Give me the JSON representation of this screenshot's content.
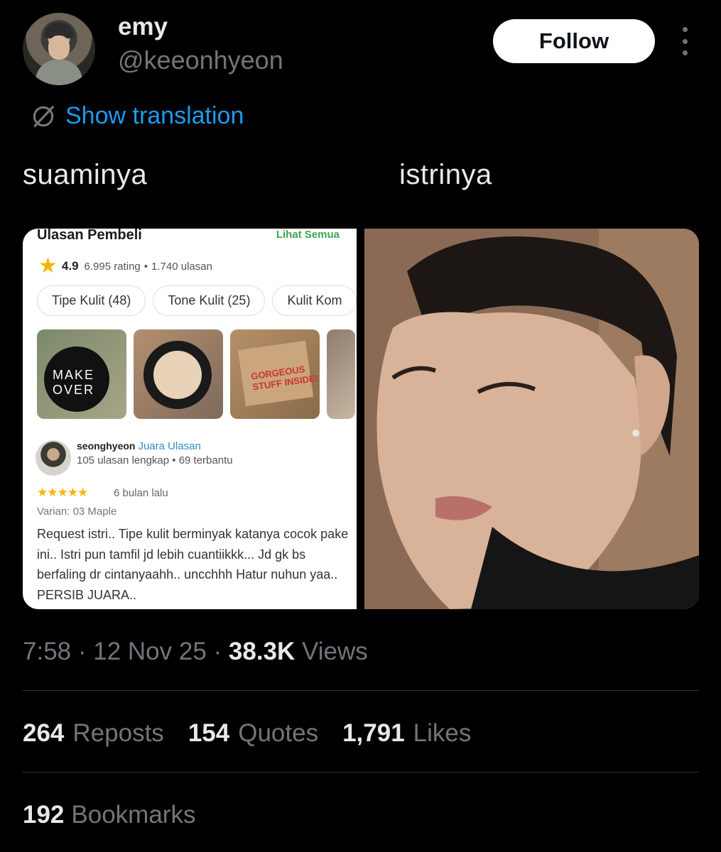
{
  "author": {
    "name": "emy",
    "handle": "@keeonhyeon",
    "follow_label": "Follow"
  },
  "translate": {
    "label": "Show translation"
  },
  "post": {
    "caption_left": "suaminya",
    "caption_right": "istrinya"
  },
  "review": {
    "title": "Ulasan Pembeli",
    "see_all": "Lihat Semua",
    "score": "4.9",
    "rating_count": "6.995 rating",
    "review_count": "1.740 ulasan",
    "chips": [
      "Tipe Kulit (48)",
      "Tone Kulit (25)",
      "Kulit Kom"
    ],
    "photo_labels": [
      "MAKE OVER",
      "GORGEOUS STUFF INSIDE!"
    ],
    "reviewer": "seonghyeon",
    "badge": "Juara Ulasan",
    "reviewer_meta": "105 ulasan lengkap • 69 terbantu",
    "stars": "★★★★★",
    "when": "6 bulan lalu",
    "variant": "Varian: 03 Maple",
    "body": "Request istri.. Tipe kulit berminyak katanya cocok pake ini.. Istri pun tamfil jd lebih cuantiikkk... Jd gk bs berfaling dr cintanyaahh.. uncchhh Hatur nuhun yaa.. PERSIB JUARA.."
  },
  "meta": {
    "time": "7:58",
    "date": "12 Nov 25",
    "views_count": "38.3K",
    "views_label": "Views"
  },
  "stats": {
    "reposts_count": "264",
    "reposts_label": "Reposts",
    "quotes_count": "154",
    "quotes_label": "Quotes",
    "likes_count": "1,791",
    "likes_label": "Likes",
    "bookmarks_count": "192",
    "bookmarks_label": "Bookmarks"
  },
  "colors": {
    "accent": "#1d9bf0",
    "muted": "#71767b",
    "text": "#e7e9ea"
  },
  "icons": {
    "more": "more-vertical-icon",
    "translate": "translate-globe-icon",
    "star": "star-icon"
  }
}
